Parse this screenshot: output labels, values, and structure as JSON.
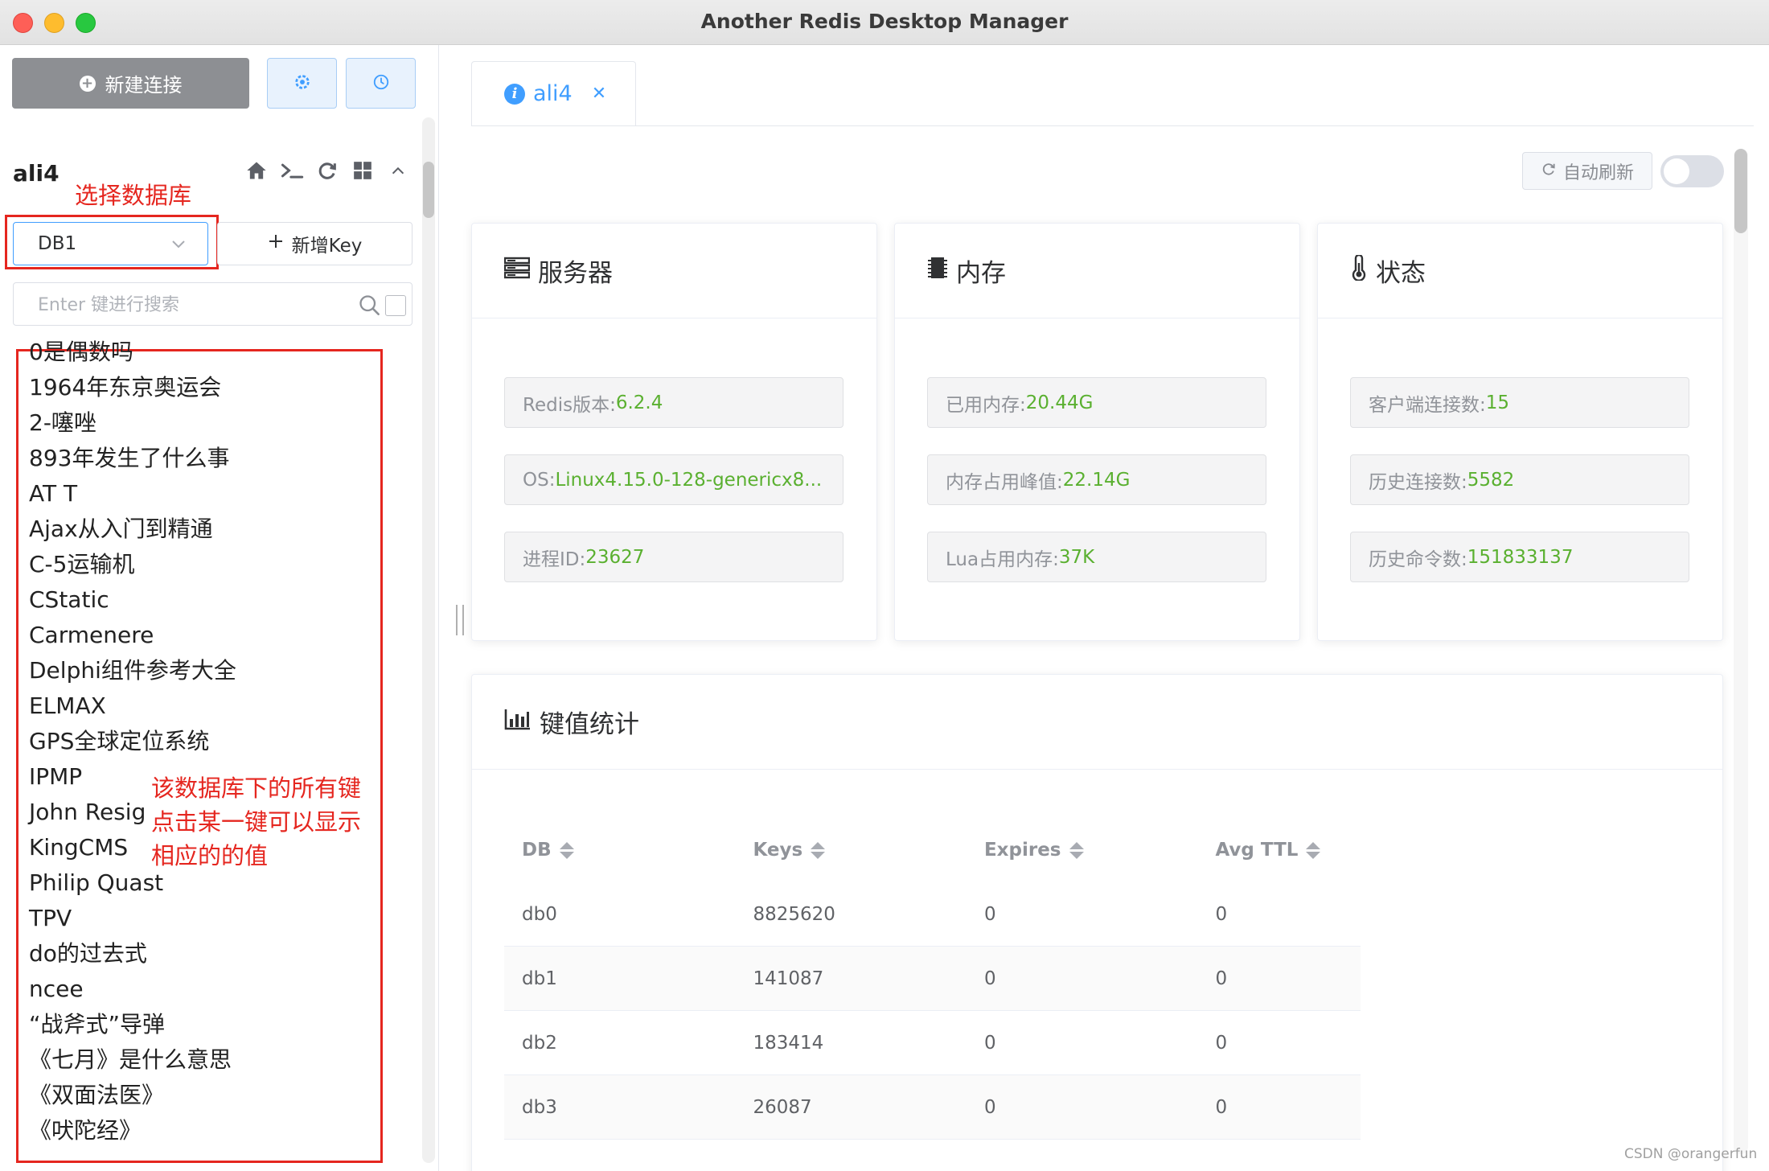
{
  "window": {
    "title": "Another Redis Desktop Manager"
  },
  "sidebar": {
    "new_connection_label": "新建连接",
    "connection_name": "ali4",
    "db_select": {
      "value": "DB1"
    },
    "new_key_label": "新增Key",
    "search": {
      "placeholder": "Enter 键进行搜索",
      "value": ""
    },
    "keys": [
      "0是偶数吗",
      "1964年东京奥运会",
      "2-噻唑",
      "893年发生了什么事",
      "AT T",
      "Ajax从入门到精通",
      "C-5运输机",
      "CStatic",
      "Carmenere",
      "Delphi组件参考大全",
      "ELMAX",
      "GPS全球定位系统",
      "IPMP",
      "John Resig",
      "KingCMS",
      "Philip Quast",
      "TPV",
      "do的过去式",
      "ncee",
      "“战斧式”导弹",
      "《七月》是什么意思",
      "《双面法医》",
      "《吠陀经》"
    ]
  },
  "annotations": {
    "select_db": "选择数据库",
    "all_keys_line1": "该数据库下的所有键",
    "all_keys_line2": "点击某一键可以显示",
    "all_keys_line3": "相应的的值"
  },
  "main": {
    "tab_label": "ali4",
    "auto_refresh_label": "自动刷新",
    "auto_refresh_on": false,
    "server_card": {
      "title": "服务器",
      "items": [
        {
          "label": "Redis版本: ",
          "value": "6.2.4"
        },
        {
          "label": "OS: ",
          "value": "Linux4.15.0-128-genericx8..."
        },
        {
          "label": "进程ID: ",
          "value": "23627"
        }
      ]
    },
    "memory_card": {
      "title": "内存",
      "items": [
        {
          "label": "已用内存: ",
          "value": "20.44G"
        },
        {
          "label": "内存占用峰值: ",
          "value": "22.14G"
        },
        {
          "label": "Lua占用内存: ",
          "value": "37K"
        }
      ]
    },
    "status_card": {
      "title": "状态",
      "items": [
        {
          "label": "客户端连接数: ",
          "value": "15"
        },
        {
          "label": "历史连接数: ",
          "value": "5582"
        },
        {
          "label": "历史命令数: ",
          "value": "151833137"
        }
      ]
    },
    "key_stats": {
      "title": "键值统计",
      "columns": [
        "DB",
        "Keys",
        "Expires",
        "Avg TTL"
      ],
      "rows": [
        [
          "db0",
          "8825620",
          "0",
          "0"
        ],
        [
          "db1",
          "141087",
          "0",
          "0"
        ],
        [
          "db2",
          "183414",
          "0",
          "0"
        ],
        [
          "db3",
          "26087",
          "0",
          "0"
        ]
      ]
    }
  },
  "watermark": "CSDN @orangerfun",
  "colors": {
    "accent": "#409eff",
    "value_green": "#5ab030",
    "annotation_red": "#e5261f"
  }
}
